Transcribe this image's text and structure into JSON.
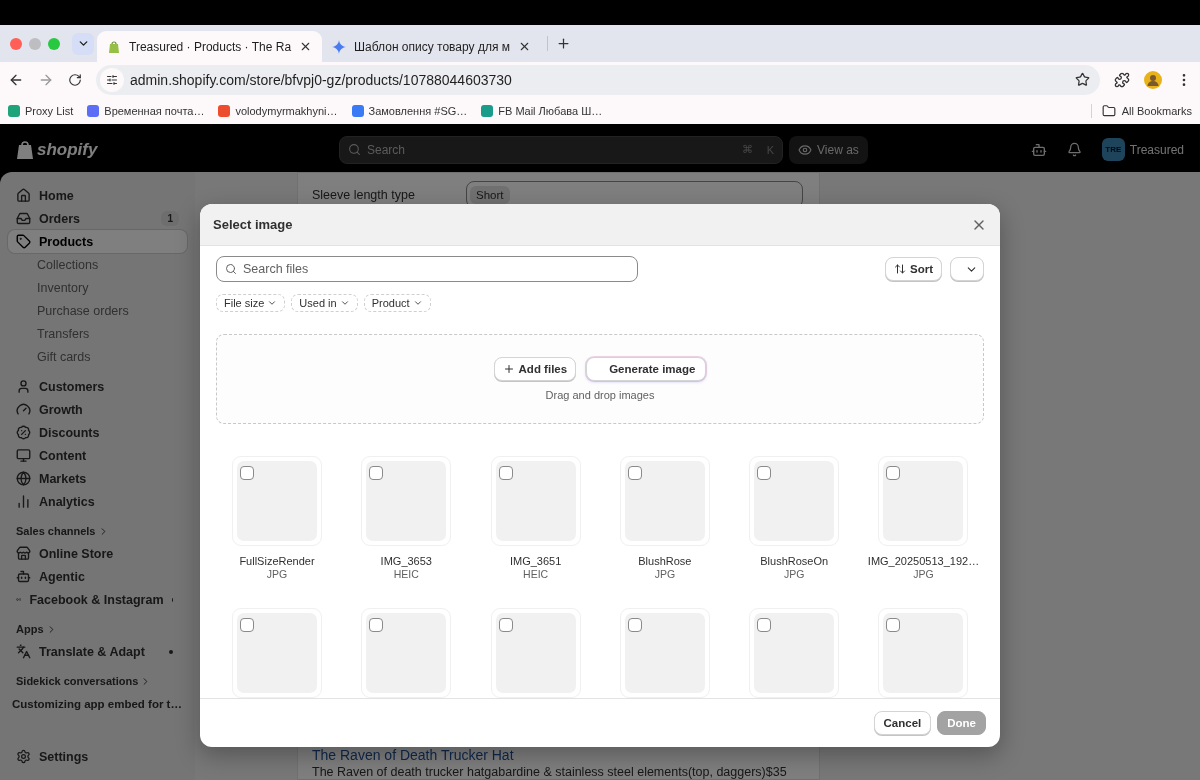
{
  "browser": {
    "tabs": [
      {
        "title": "Treasured · Products · The Ra",
        "selected": true,
        "kind": "shopify"
      },
      {
        "title": "Шаблон опису товару для м",
        "selected": false,
        "kind": "gemini"
      }
    ],
    "url": "admin.shopify.com/store/bfvpj0-gz/products/10788044603730",
    "bookmarks": [
      {
        "label": "Proxy List",
        "color": "#1fa37a"
      },
      {
        "label": "Временная почта…",
        "color": "#5b6ef5"
      },
      {
        "label": "volodymyrmakhyni…",
        "color": "#ee4d2d"
      },
      {
        "label": "Замовлення #SG…",
        "color": "#3a7bf5"
      },
      {
        "label": "FB Mail Любава Ш…",
        "color": "#1a9c8a"
      }
    ],
    "all_bookmarks": "All Bookmarks"
  },
  "topbar": {
    "logo": "shopify",
    "search_placeholder": "Search",
    "shortcut": [
      "⌘",
      "K"
    ],
    "view_as": "View as",
    "store_initials": "TRE",
    "store_name": "Treasured"
  },
  "sidebar": {
    "groups": [
      {
        "items": [
          {
            "label": "Home",
            "selected": false
          },
          {
            "label": "Orders",
            "selected": false,
            "badge": "1"
          },
          {
            "label": "Products",
            "selected": true,
            "children": [
              {
                "label": "Collections",
                "selected": false
              },
              {
                "label": "Inventory",
                "selected": false
              },
              {
                "label": "Purchase orders",
                "selected": false
              },
              {
                "label": "Transfers",
                "selected": false
              },
              {
                "label": "Gift cards",
                "selected": false
              }
            ]
          }
        ]
      },
      {
        "items": [
          {
            "label": "Customers",
            "selected": false
          },
          {
            "label": "Growth",
            "selected": false
          },
          {
            "label": "Discounts",
            "selected": false
          },
          {
            "label": "Content",
            "selected": false
          },
          {
            "label": "Markets",
            "selected": false
          },
          {
            "label": "Analytics",
            "selected": false
          }
        ]
      },
      {
        "heading": "Sales channels",
        "items": [
          {
            "label": "Online Store",
            "selected": false
          },
          {
            "label": "Agentic",
            "selected": false
          },
          {
            "label": "Facebook & Instagram",
            "selected": false,
            "dot": true
          }
        ]
      },
      {
        "heading": "Apps",
        "items": [
          {
            "label": "Translate & Adapt",
            "selected": false,
            "dot": true
          }
        ]
      },
      {
        "heading": "Sidekick conversations",
        "items": [
          {
            "label": "Customizing app embed for t…",
            "kind": "conversation"
          }
        ]
      }
    ],
    "settings": "Settings"
  },
  "page": {
    "field_label": "Sleeve length type",
    "field_tag": "Short",
    "product_link": "The Raven of Death Trucker Hat",
    "product_description": "The Raven of death trucker hatgabardine & stainless steel elements(top, daggers)$35"
  },
  "modal": {
    "title": "Select image",
    "search_placeholder": "Search files",
    "sort": "Sort",
    "filters": [
      "File size",
      "Used in",
      "Product"
    ],
    "upload_buttons": [
      {
        "label": "Add files",
        "kind": "add"
      },
      {
        "label": "Generate image",
        "kind": "generate"
      }
    ],
    "drop_hint": "Drag and drop images",
    "files": [
      {
        "name": "FullSizeRender",
        "type": "JPG",
        "checked": false
      },
      {
        "name": "IMG_3653",
        "type": "HEIC",
        "checked": false
      },
      {
        "name": "IMG_3651",
        "type": "HEIC",
        "checked": false
      },
      {
        "name": "BlushRose",
        "type": "JPG",
        "checked": false
      },
      {
        "name": "BlushRoseOn",
        "type": "JPG",
        "checked": false
      },
      {
        "name": "IMG_20250513_192…",
        "type": "JPG",
        "checked": false
      },
      {
        "checked": false
      },
      {
        "checked": false
      },
      {
        "checked": false
      },
      {
        "checked": false
      },
      {
        "checked": false
      },
      {
        "checked": false
      }
    ],
    "footer_buttons": [
      {
        "label": "Cancel",
        "disabled": false
      },
      {
        "label": "Done",
        "disabled": true
      }
    ]
  }
}
